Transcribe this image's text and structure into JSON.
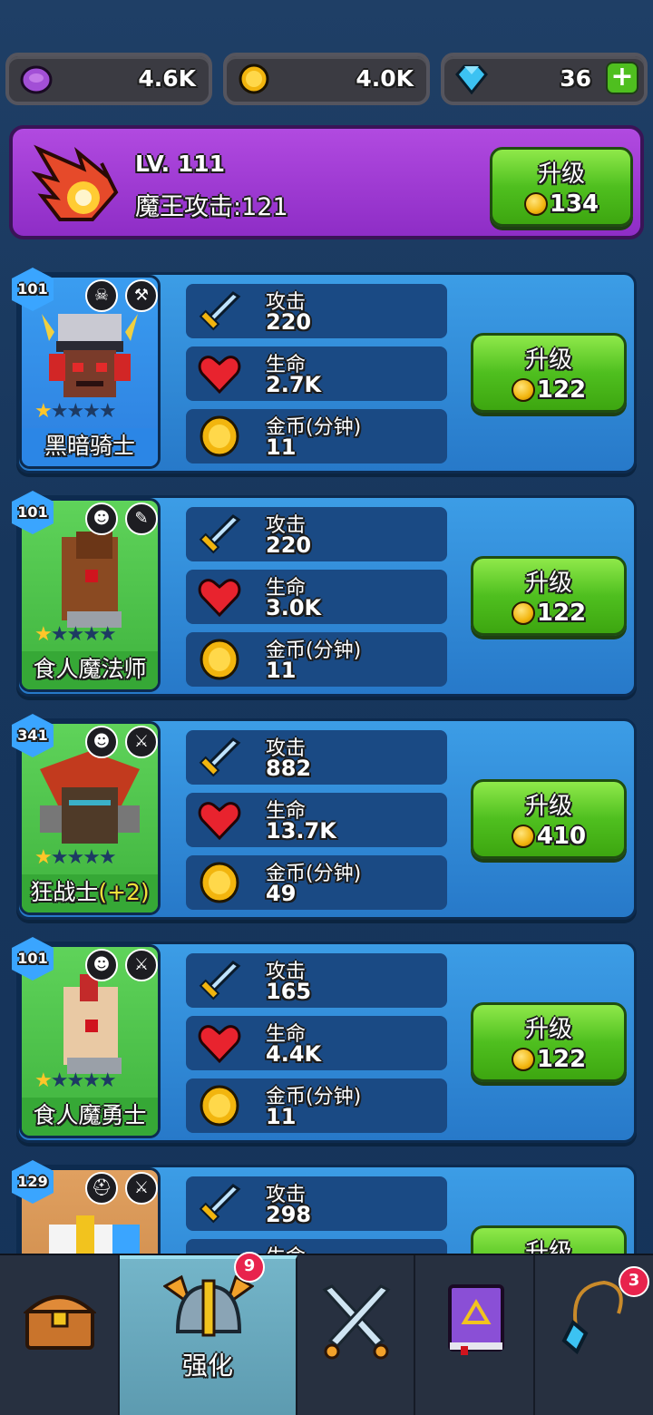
{
  "resources": {
    "potion": {
      "value": "4.6K",
      "icon": "purple-orb-icon"
    },
    "gold": {
      "value": "4.0K",
      "icon": "gold-coin-icon"
    },
    "gems": {
      "value": "36",
      "icon": "diamond-icon",
      "add_label": "+"
    }
  },
  "boss": {
    "level": "LV. 111",
    "attack_label": "魔王攻击:121",
    "upgrade_label": "升级",
    "upgrade_cost": "134"
  },
  "heroes": [
    {
      "level": "101",
      "name": "黑暗骑士",
      "attack_label": "攻击",
      "attack": "220",
      "hp_label": "生命",
      "hp": "2.7K",
      "gold_label": "金币(分钟)",
      "gold": "11",
      "upgrade_label": "升级",
      "upgrade_cost": "122"
    },
    {
      "level": "101",
      "name": "食人魔法师",
      "attack_label": "攻击",
      "attack": "220",
      "hp_label": "生命",
      "hp": "3.0K",
      "gold_label": "金币(分钟)",
      "gold": "11",
      "upgrade_label": "升级",
      "upgrade_cost": "122"
    },
    {
      "level": "341",
      "name": "狂战士",
      "name_bonus": "(+2)",
      "attack_label": "攻击",
      "attack": "882",
      "hp_label": "生命",
      "hp": "13.7K",
      "gold_label": "金币(分钟)",
      "gold": "49",
      "upgrade_label": "升级",
      "upgrade_cost": "410"
    },
    {
      "level": "101",
      "name": "食人魔勇士",
      "attack_label": "攻击",
      "attack": "165",
      "hp_label": "生命",
      "hp": "4.4K",
      "gold_label": "金币(分钟)",
      "gold": "11",
      "upgrade_label": "升级",
      "upgrade_cost": "122"
    },
    {
      "level": "129",
      "attack_label": "攻击",
      "attack": "298",
      "hp_label": "生命",
      "upgrade_label": "升级"
    }
  ],
  "nav": {
    "tabs": [
      {
        "icon": "treasure-chest-icon"
      },
      {
        "icon": "viking-helmet-icon",
        "label": "强化",
        "badge": "9"
      },
      {
        "icon": "crossed-swords-icon"
      },
      {
        "icon": "spell-book-icon"
      },
      {
        "icon": "amulet-icon",
        "badge": "3"
      }
    ]
  }
}
